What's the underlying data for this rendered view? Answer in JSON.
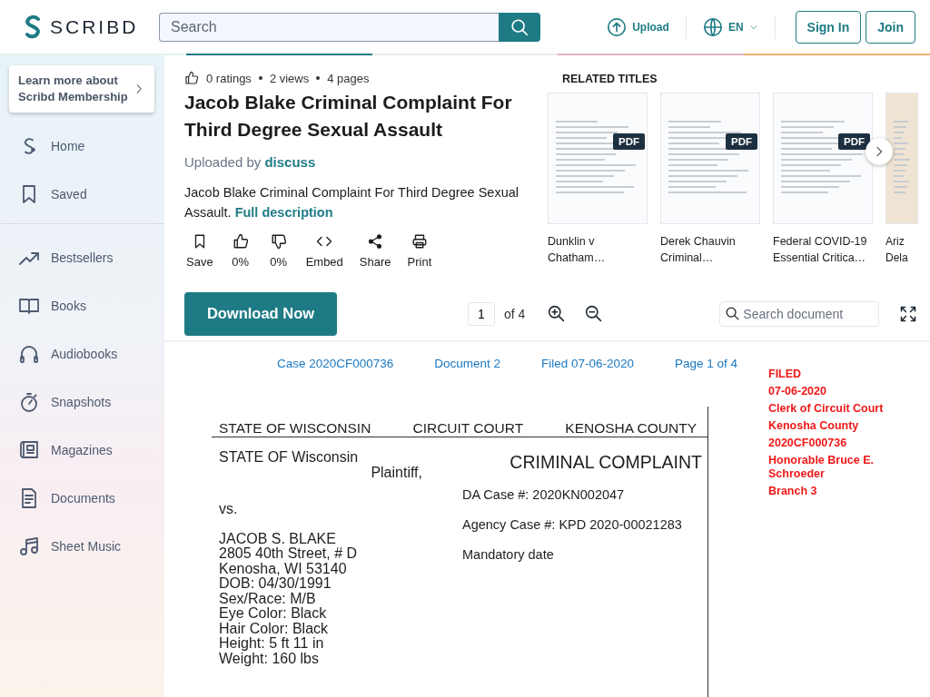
{
  "header": {
    "logo": "SCRIBD",
    "search": {
      "placeholder": "Search"
    },
    "upload": "Upload",
    "language": "EN",
    "sign_in": "Sign In",
    "join": "Join"
  },
  "sidebar": {
    "promo": "Learn more about Scribd Membership",
    "primary_items": [
      {
        "kind": "home",
        "label": "Home"
      },
      {
        "kind": "saved",
        "label": "Saved"
      }
    ],
    "browse_items": [
      {
        "kind": "bestsellers",
        "label": "Bestsellers"
      },
      {
        "kind": "books",
        "label": "Books"
      },
      {
        "kind": "audiobooks",
        "label": "Audiobooks"
      },
      {
        "kind": "snapshots",
        "label": "Snapshots"
      },
      {
        "kind": "magazines",
        "label": "Magazines"
      },
      {
        "kind": "documents",
        "label": "Documents"
      },
      {
        "kind": "sheet_music",
        "label": "Sheet Music"
      }
    ]
  },
  "document": {
    "stats": [
      "0 ratings",
      "2 views",
      "4 pages"
    ],
    "title": "Jacob Blake Criminal Complaint For Third Degree Sexual Assault",
    "uploaded_by": "Uploaded by",
    "uploader": "discuss",
    "description": "Jacob Blake Criminal Complaint For Third Degree Sexual Assault.",
    "full_description": "Full description",
    "actions": [
      {
        "kind": "save",
        "label": "Save"
      },
      {
        "kind": "like",
        "label": "0%"
      },
      {
        "kind": "dislike",
        "label": "0%"
      },
      {
        "kind": "embed",
        "label": "Embed"
      },
      {
        "kind": "share",
        "label": "Share"
      },
      {
        "kind": "print",
        "label": "Print"
      }
    ],
    "download": "Download Now"
  },
  "related": {
    "heading": "RELATED TITLES",
    "items": [
      {
        "title": "Dunklin v Chatham…",
        "badge": "PDF"
      },
      {
        "title": "Derek Chauvin Criminal…",
        "badge": "PDF"
      },
      {
        "title": "Federal COVID-19 Essential Critica…",
        "badge": "PDF"
      },
      {
        "title": "Ariz Dela"
      }
    ]
  },
  "viewer": {
    "page": "1",
    "page_count": "of 4",
    "search": {
      "placeholder": "Search document"
    }
  },
  "page": {
    "header": [
      "Case 2020CF000736",
      "Document 2",
      "Filed 07-06-2020",
      "Page 1 of 4"
    ],
    "stamp": [
      "FILED",
      "07-06-2020",
      "Clerk of Circuit Court",
      "Kenosha County",
      "2020CF000736",
      "Honorable Bruce E. Schroeder",
      "Branch 3"
    ],
    "court_row": [
      "STATE OF WISCONSIN",
      "CIRCUIT COURT",
      "KENOSHA COUNTY"
    ],
    "plaintiff": "STATE OF Wisconsin",
    "plaintiff_role": "Plaintiff,",
    "versus": "vs.",
    "defendant": [
      "JACOB S. BLAKE",
      "2805 40th Street, # D",
      "Kenosha, WI 53140",
      "DOB: 04/30/1991",
      "Sex/Race: M/B",
      "Eye Color: Black",
      "Hair Color: Black",
      "Height: 5 ft 11 in",
      "Weight: 160 lbs"
    ],
    "complaint_title": "CRIMINAL COMPLAINT",
    "case_lines": [
      "DA Case #: 2020KN002047",
      "Agency Case #: KPD 2020-00021283",
      "Mandatory date"
    ]
  }
}
